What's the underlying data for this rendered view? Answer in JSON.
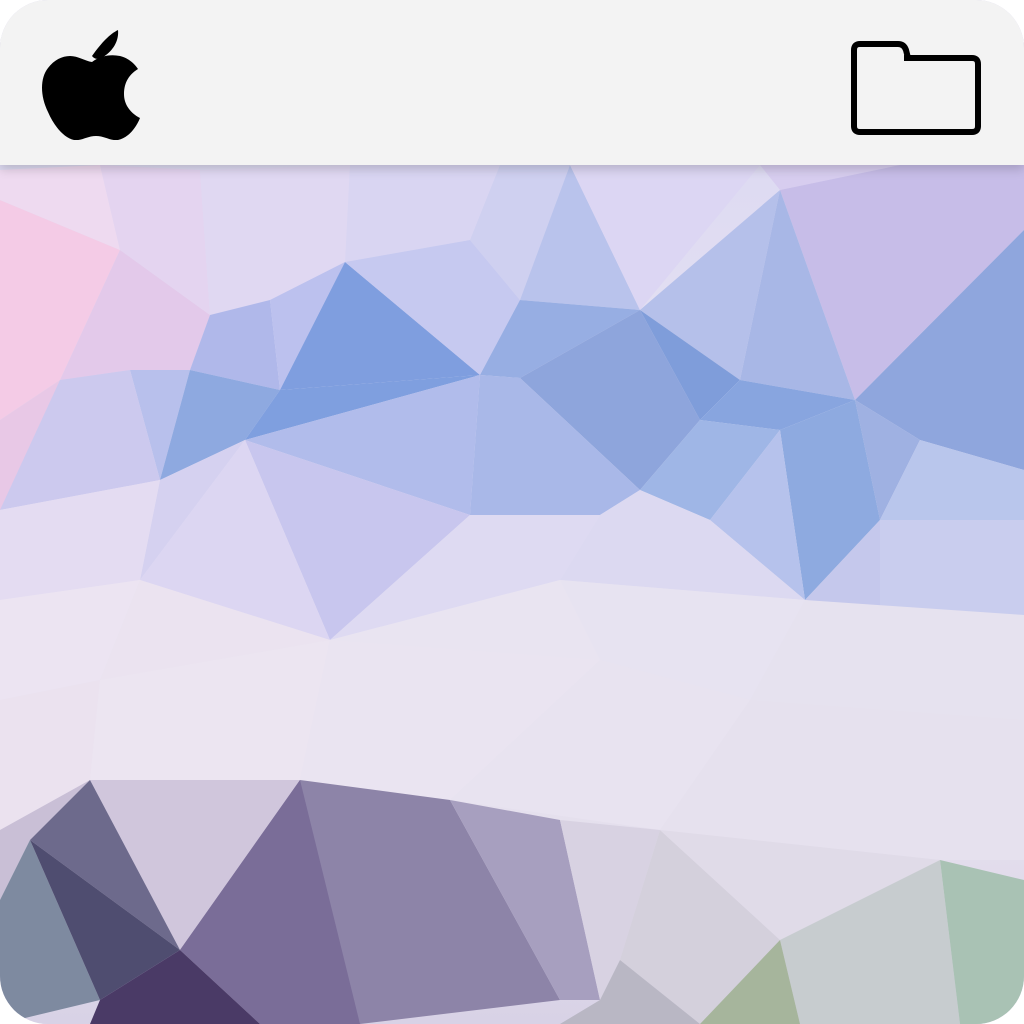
{
  "menubar": {
    "logo_icon": "apple-logo-icon",
    "folder_icon": "folder-icon",
    "background_color": "#f3f3f3"
  },
  "wallpaper": {
    "style": "low-poly gradient",
    "palette": [
      "#f6c8e4",
      "#a8b4e8",
      "#7e9ad8",
      "#e8e2ef",
      "#8f88ae",
      "#5a4d78",
      "#a9c2b0"
    ]
  }
}
